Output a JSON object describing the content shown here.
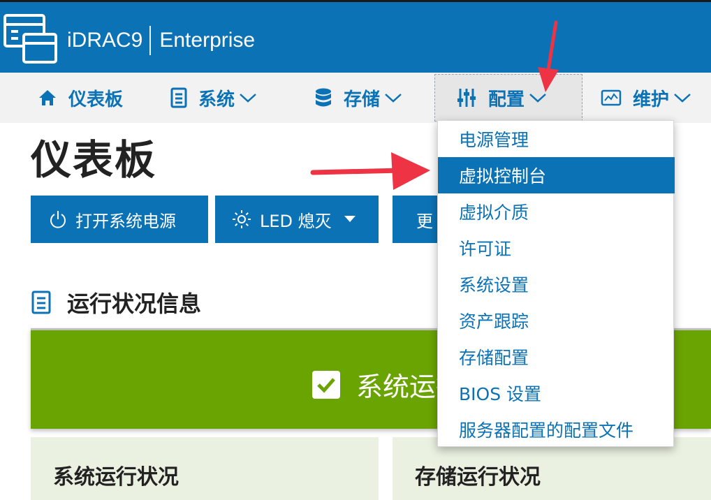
{
  "header": {
    "brand_name": "iDRAC9",
    "brand_edition": "Enterprise"
  },
  "nav": {
    "dashboard": "仪表板",
    "system": "系统",
    "storage": "存储",
    "configuration": "配置",
    "maintenance": "维护"
  },
  "page": {
    "title": "仪表板"
  },
  "actions": {
    "power_on": "打开系统电源",
    "led_off": "LED 熄灭",
    "more": "更"
  },
  "health": {
    "section_title": "运行状况信息",
    "banner_text": "系统运行",
    "system_health": "系统运行状况",
    "storage_health": "存储运行状况"
  },
  "config_menu": {
    "items": [
      "电源管理",
      "虚拟控制台",
      "虚拟介质",
      "许可证",
      "系统设置",
      "资产跟踪",
      "存储配置",
      "BIOS 设置",
      "服务器配置的配置文件"
    ],
    "highlighted": "虚拟控制台"
  },
  "colors": {
    "primary": "#0b72b5",
    "nav_bg": "#f2f2f2",
    "health_ok": "#6aa402",
    "card_bg": "#eaf1e0",
    "annotation_arrow": "#ee3344"
  }
}
